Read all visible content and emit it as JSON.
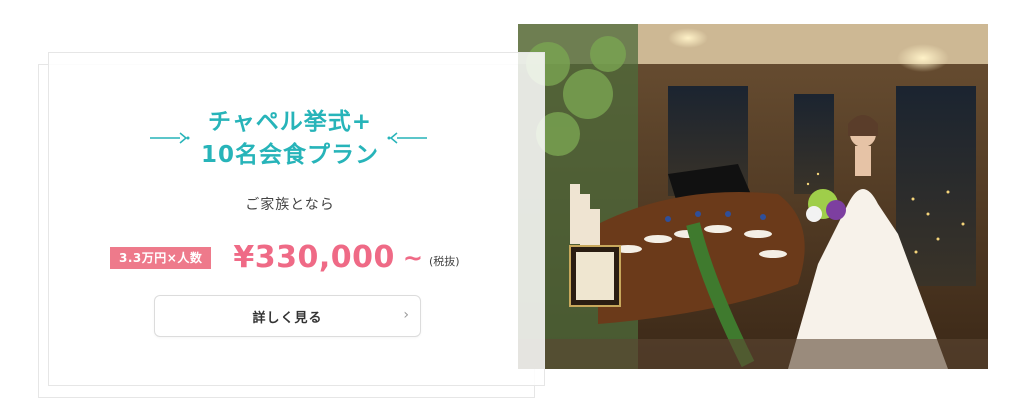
{
  "plan": {
    "title_line1": "チャペル挙式+",
    "title_line2": "10名会食プラン",
    "subtitle": "ご家族となら",
    "badge": "3.3万円×人数",
    "price": "¥330,000",
    "price_suffix": "~",
    "tax_note": "(税抜)",
    "button_label": "詳しく見る",
    "button_icon": "chevron-right-icon"
  },
  "colors": {
    "accent_teal": "#27b4b9",
    "price_pink": "#ef6a86",
    "badge_pink": "#ee7a8b"
  }
}
